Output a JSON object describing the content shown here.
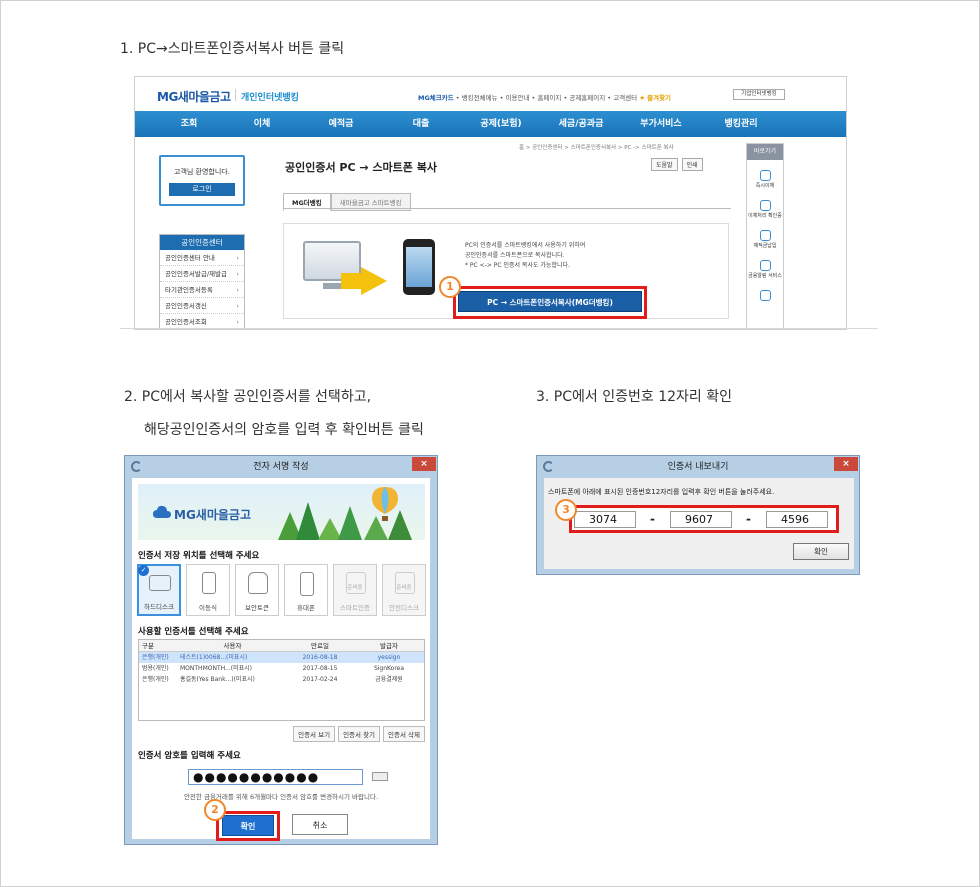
{
  "steps": {
    "s1": "1. PC→스마트폰인증서복사 버튼 클릭",
    "s2a": "2. PC에서 복사할 공인인증서를 선택하고,",
    "s2b": "해당공인인증서의 암호를 입력 후 확인버튼 클릭",
    "s3": "3. PC에서 인증번호 12자리 확인"
  },
  "site": {
    "logo": "MG새마을금고",
    "logo_sub": "개인인터넷뱅킹",
    "top_links": [
      "MG체크카드",
      "뱅킹전체메뉴",
      "이용안내",
      "홈페이지",
      "공제홈페이지",
      "고객센터",
      "즐겨찾기"
    ],
    "site_select": "기업인터넷뱅킹",
    "nav": [
      "조회",
      "이체",
      "예적금",
      "대출",
      "공제(보험)",
      "세금/공과금",
      "부가서비스",
      "뱅킹관리"
    ],
    "greeting": "고객님 환영합니다.",
    "login": "로그인",
    "menu_header": "공인인증센터",
    "menu_items": [
      "공인인증센터 안내",
      "공인인증서발급/재발급",
      "타기관인증서등록",
      "공인인증서갱신",
      "공인인증서조회"
    ],
    "page_title": "공인인증서 PC → 스마트폰 복사",
    "breadcrumb": "홈 > 공인인증센터 > 스마트폰인증서복사 > PC -> 스마트폰 복사",
    "help": "도움말",
    "print": "인쇄",
    "tabs": [
      "MG더뱅킹",
      "새마을금고 스마트뱅킹"
    ],
    "desc_lines": [
      "PC의 인증서를 스마트뱅킹에서 사용하기 위하여",
      "공인인증서를 스마트폰으로 복사합니다.",
      "* PC <-> PC 인증서 복사도 가능합니다."
    ],
    "copy_button": "PC → 스마트폰인증서복사(MG더뱅킹)",
    "quick_header": "바로가기",
    "quick_items": [
      "즉시이체",
      "이체처리 확인증",
      "예적금납입",
      "금융알림 서비스"
    ]
  },
  "badges": {
    "b1": "1",
    "b2": "2",
    "b3": "3"
  },
  "sign_dialog": {
    "title": "전자 서명 작성",
    "close": "×",
    "banner_logo": "MG새마을금고",
    "location_label": "인증서 저장 위치를 선택해 주세요",
    "locations": [
      "하드디스크",
      "이동식",
      "보안토큰",
      "휴대폰",
      "스마트인증",
      "안전디스크"
    ],
    "location_disabled_caption": "준비중",
    "cert_label": "사용할 인증서를 선택해 주세요",
    "columns": [
      "구분",
      "사용자",
      "만료일",
      "발급자"
    ],
    "rows": [
      {
        "kind": "은행(개인)",
        "user": "테스트(1)0068...(미표시)",
        "exp": "2016-08-18",
        "issuer": "yessign"
      },
      {
        "kind": "범용(개인)",
        "user": "MONTHMONTH...(미표시)",
        "exp": "2017-08-15",
        "issuer": "SignKorea"
      },
      {
        "kind": "은행(개인)",
        "user": "홍길동(Yes Bank...)(미표시)",
        "exp": "2017-02-24",
        "issuer": "금융결제원"
      }
    ],
    "buttons": [
      "인증서 보기",
      "인증서 찾기",
      "인증서 삭제"
    ],
    "password_label": "인증서 암호를 입력해 주세요",
    "password_value": "●●●●●●●●●●●",
    "hint": "안전한 금융거래를 위해 6개월마다 인증서 암호를 변경하시기 바랍니다.",
    "ok": "확인",
    "cancel": "취소"
  },
  "export_dialog": {
    "title": "인증서 내보내기",
    "close": "×",
    "message": "스마트폰에 아래에 표시된 인증번호12자리를 입력후 확인 버튼을 눌러주세요.",
    "codes": [
      "3074",
      "9607",
      "4596"
    ],
    "separator": "-",
    "ok": "확인"
  }
}
